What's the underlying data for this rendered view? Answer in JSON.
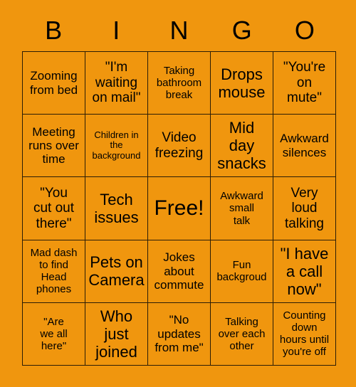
{
  "card": {
    "title": "BINGO",
    "background_color": "#F0960E",
    "border_color": "#2b1d06",
    "text_color": "#000000"
  },
  "header": {
    "letters": [
      "B",
      "I",
      "N",
      "G",
      "O"
    ]
  },
  "grid": {
    "columns": 5,
    "rows": 5,
    "cells": [
      {
        "text": "Zooming\nfrom bed",
        "size": "fs-m"
      },
      {
        "text": "\"I'm\nwaiting\non mail\"",
        "size": "fs-l"
      },
      {
        "text": "Taking\nbathroom\nbreak",
        "size": "fs-s"
      },
      {
        "text": "Drops\nmouse",
        "size": "fs-xl"
      },
      {
        "text": "\"You're\non\nmute\"",
        "size": "fs-l"
      },
      {
        "text": "Meeting\nruns over\ntime",
        "size": "fs-m"
      },
      {
        "text": "Children in\nthe\nbackground",
        "size": "fs-xs"
      },
      {
        "text": "Video\nfreezing",
        "size": "fs-l"
      },
      {
        "text": "Mid\nday\nsnacks",
        "size": "fs-xl"
      },
      {
        "text": "Awkward\nsilences",
        "size": "fs-m"
      },
      {
        "text": "\"You\ncut out\nthere\"",
        "size": "fs-l"
      },
      {
        "text": "Tech\nissues",
        "size": "fs-xl"
      },
      {
        "text": "Free!",
        "size": "fs-free"
      },
      {
        "text": "Awkward\nsmall\ntalk",
        "size": "fs-s"
      },
      {
        "text": "Very\nloud\ntalking",
        "size": "fs-l"
      },
      {
        "text": "Mad dash\nto find\nHead\nphones",
        "size": "fs-s"
      },
      {
        "text": "Pets on\nCamera",
        "size": "fs-xl"
      },
      {
        "text": "Jokes\nabout\ncommute",
        "size": "fs-m"
      },
      {
        "text": "Fun\nbackgroud",
        "size": "fs-s"
      },
      {
        "text": "\"I have\na call\nnow\"",
        "size": "fs-xl"
      },
      {
        "text": "\"Are\nwe all\nhere\"",
        "size": "fs-s"
      },
      {
        "text": "Who\njust\njoined",
        "size": "fs-xl"
      },
      {
        "text": "\"No\nupdates\nfrom me\"",
        "size": "fs-m"
      },
      {
        "text": "Talking\nover each\nother",
        "size": "fs-s"
      },
      {
        "text": "Counting\ndown\nhours until\nyou're off",
        "size": "fs-s"
      }
    ]
  }
}
